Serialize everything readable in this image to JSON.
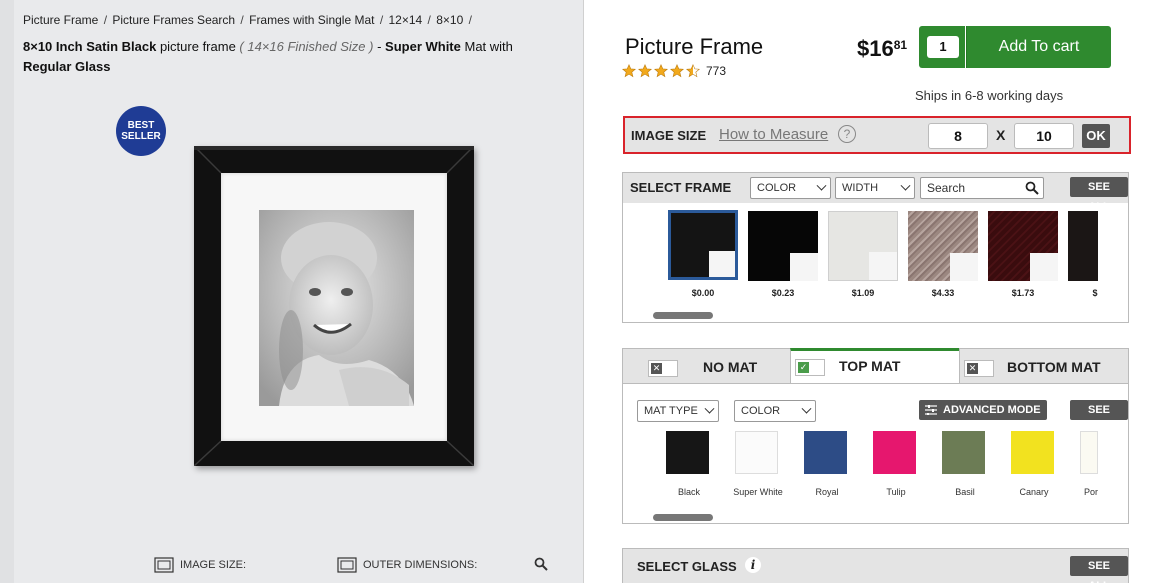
{
  "breadcrumb": [
    "Picture Frame",
    "Picture Frames Search",
    "Frames with Single Mat",
    "12×14",
    "8×10",
    ""
  ],
  "product_title": {
    "part1": "8×10 Inch Satin Black",
    "part2": " picture frame ",
    "part3": "( 14×16 Finished Size )",
    "part4": " - ",
    "part5": "Super White",
    "part6": " Mat with ",
    "part7": "Regular Glass"
  },
  "badge": {
    "line1": "BEST",
    "line2": "SELLER"
  },
  "left_bottom": {
    "image_size": "IMAGE SIZE:",
    "outer_dimensions": "OUTER DIMENSIONS:"
  },
  "product": {
    "name": "Picture Frame",
    "rating_stars": 4.5,
    "review_count": "773",
    "price_dollars": "$16",
    "price_cents": "81",
    "quantity": "1",
    "add_to_cart": "Add To cart",
    "ships": "Ships in 6-8 working days"
  },
  "image_size": {
    "label": "IMAGE SIZE",
    "how_to_measure": "How to Measure",
    "help": "?",
    "width": "8",
    "x": "X",
    "height": "10",
    "ok": "OK"
  },
  "select_frame": {
    "title": "SELECT FRAME",
    "color": "COLOR",
    "width": "WIDTH",
    "search_placeholder": "Search",
    "see_all": "SEE ALL",
    "frames": [
      {
        "price": "$0.00",
        "color": "#141414"
      },
      {
        "price": "$0.23",
        "color": "#060606"
      },
      {
        "price": "$1.09",
        "color": "#e6e6e3"
      },
      {
        "price": "$4.33",
        "color": "#9b8780"
      },
      {
        "price": "$1.73",
        "color": "#3a0c0e"
      },
      {
        "price": "$",
        "color": "#1b1615"
      }
    ]
  },
  "mat_tabs": {
    "no_mat": "NO MAT",
    "top_mat": "TOP MAT",
    "bottom_mat": "BOTTOM MAT"
  },
  "mat_panel": {
    "mat_type": "MAT TYPE",
    "color": "COLOR",
    "advanced_mode": "ADVANCED MODE",
    "see_all": "SEE ALL",
    "mats": [
      {
        "name": "Black",
        "color": "#161616"
      },
      {
        "name": "Super White",
        "color": "#fbfbfb"
      },
      {
        "name": "Royal",
        "color": "#2d4c86"
      },
      {
        "name": "Tulip",
        "color": "#e6176e"
      },
      {
        "name": "Basil",
        "color": "#6c7c55"
      },
      {
        "name": "Canary",
        "color": "#f2e21f"
      },
      {
        "name": "Por",
        "color": "#fbfaf2"
      }
    ]
  },
  "glass": {
    "title": "SELECT GLASS",
    "see_all": "SEE ALL"
  },
  "colors": {
    "cart_green": "#2f8a2f",
    "highlight_red": "#d9232b",
    "badge_blue": "#1f3c95"
  }
}
